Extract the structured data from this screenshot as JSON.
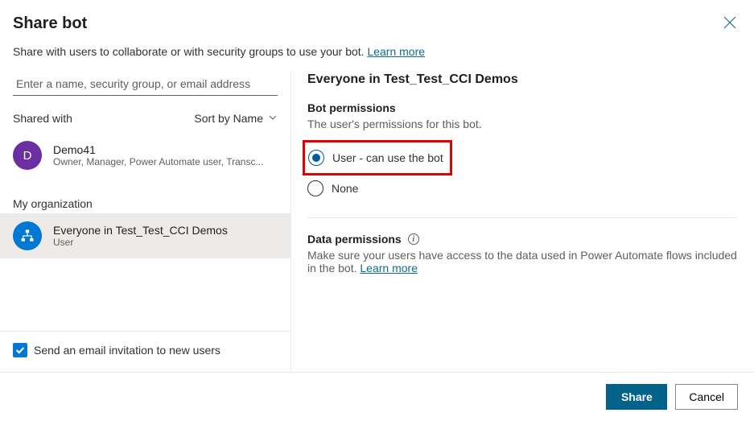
{
  "dialog": {
    "title": "Share bot",
    "subtitle_prefix": "Share with users to collaborate or with security groups to use your bot. ",
    "learn_more": "Learn more"
  },
  "left": {
    "search_placeholder": "Enter a name, security group, or email address",
    "shared_with_label": "Shared with",
    "sort_label": "Sort by Name",
    "users": [
      {
        "name": "Demo41",
        "meta": "Owner, Manager, Power Automate user, Transc...",
        "initial": "D"
      }
    ],
    "org_label": "My organization",
    "org_items": [
      {
        "name": "Everyone in Test_Test_CCI Demos",
        "meta": "User"
      }
    ],
    "email_invite_label": "Send an email invitation to new users"
  },
  "right": {
    "panel_title": "Everyone in Test_Test_CCI Demos",
    "bot_perm_title": "Bot permissions",
    "bot_perm_sub": "The user's permissions for this bot.",
    "opt_user": "User - can use the bot",
    "opt_none": "None",
    "data_perm_title": "Data permissions",
    "data_perm_text_before": "Make sure your users have access to the data used in Power Automate flows included in the bot. ",
    "data_perm_link": "Learn more"
  },
  "footer": {
    "share": "Share",
    "cancel": "Cancel"
  }
}
